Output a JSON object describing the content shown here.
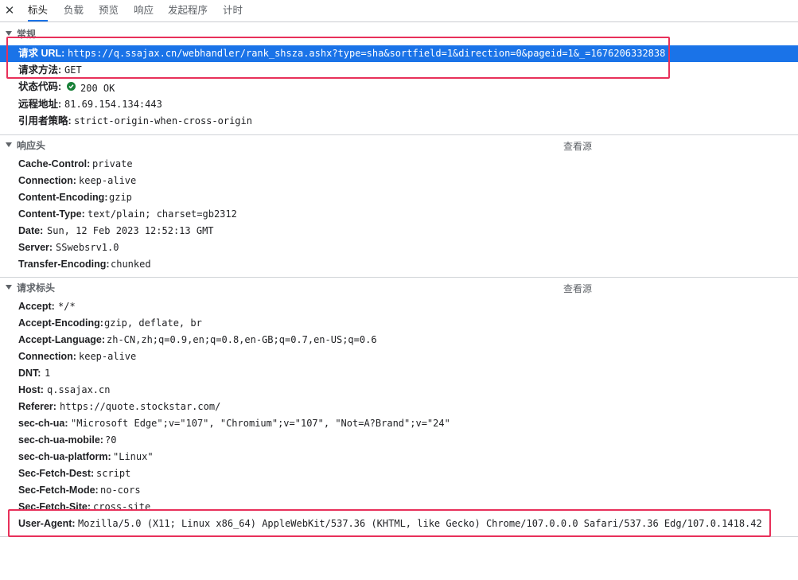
{
  "tabs": [
    {
      "label": "标头",
      "active": true
    },
    {
      "label": "负载"
    },
    {
      "label": "预览"
    },
    {
      "label": "响应"
    },
    {
      "label": "发起程序"
    },
    {
      "label": "计时"
    }
  ],
  "general": {
    "title": "常规",
    "rows": [
      {
        "key": "请求 URL:",
        "value": "https://q.ssajax.cn/webhandler/rank_shsza.ashx?type=sha&sortfield=1&direction=0&pageid=1&_=1676206332838",
        "selected": true
      },
      {
        "key": "请求方法:",
        "value": "GET"
      },
      {
        "key": "状态代码:",
        "value": "200 OK",
        "status_icon": "green-check-circle-icon"
      },
      {
        "key": "远程地址:",
        "value": "81.69.154.134:443"
      },
      {
        "key": "引用者策略:",
        "value": "strict-origin-when-cross-origin"
      }
    ]
  },
  "response_headers": {
    "title": "响应头",
    "view_source": "查看源",
    "rows": [
      {
        "key": "Cache-Control:",
        "value": "private"
      },
      {
        "key": "Connection:",
        "value": "keep-alive"
      },
      {
        "key": "Content-Encoding:",
        "value": "gzip"
      },
      {
        "key": "Content-Type:",
        "value": "text/plain; charset=gb2312"
      },
      {
        "key": "Date:",
        "value": "Sun, 12 Feb 2023 12:52:13 GMT"
      },
      {
        "key": "Server:",
        "value": "SSwebsrv1.0"
      },
      {
        "key": "Transfer-Encoding:",
        "value": "chunked"
      }
    ]
  },
  "request_headers": {
    "title": "请求标头",
    "view_source": "查看源",
    "rows": [
      {
        "key": "Accept:",
        "value": "*/*"
      },
      {
        "key": "Accept-Encoding:",
        "value": "gzip, deflate, br"
      },
      {
        "key": "Accept-Language:",
        "value": "zh-CN,zh;q=0.9,en;q=0.8,en-GB;q=0.7,en-US;q=0.6"
      },
      {
        "key": "Connection:",
        "value": "keep-alive"
      },
      {
        "key": "DNT:",
        "value": "1"
      },
      {
        "key": "Host:",
        "value": "q.ssajax.cn"
      },
      {
        "key": "Referer:",
        "value": "https://quote.stockstar.com/"
      },
      {
        "key": "sec-ch-ua:",
        "value": "\"Microsoft Edge\";v=\"107\", \"Chromium\";v=\"107\", \"Not=A?Brand\";v=\"24\""
      },
      {
        "key": "sec-ch-ua-mobile:",
        "value": "?0"
      },
      {
        "key": "sec-ch-ua-platform:",
        "value": "\"Linux\""
      },
      {
        "key": "Sec-Fetch-Dest:",
        "value": "script"
      },
      {
        "key": "Sec-Fetch-Mode:",
        "value": "no-cors"
      },
      {
        "key": "Sec-Fetch-Site:",
        "value": "cross-site"
      },
      {
        "key": "User-Agent:",
        "value": "Mozilla/5.0 (X11; Linux x86_64) AppleWebKit/537.36 (KHTML, like Gecko) Chrome/107.0.0.0 Safari/537.36 Edg/107.0.1418.42"
      }
    ]
  },
  "colors": {
    "selection": "#1a73e8",
    "highlight_box": "#e8305a",
    "status_ok": "#188038"
  }
}
